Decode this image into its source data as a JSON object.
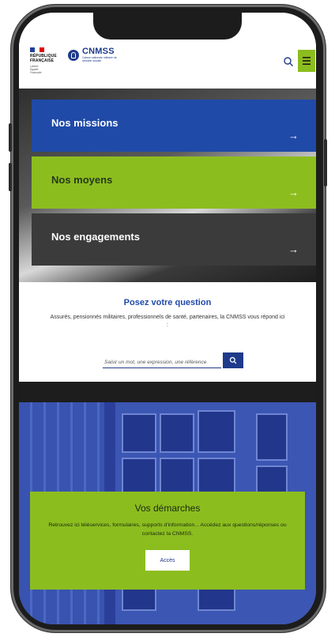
{
  "header": {
    "rf_lines": [
      "RÉPUBLIQUE",
      "FRANÇAISE"
    ],
    "rf_motto": [
      "Liberté",
      "Égalité",
      "Fraternité"
    ],
    "brand_name": "CNMSS",
    "brand_sub": "Caisse nationale militaire de sécurité sociale"
  },
  "tiles": [
    {
      "label": "Nos missions",
      "arrow": "→",
      "color": "#1f4aa8"
    },
    {
      "label": "Nos moyens",
      "arrow": "→",
      "color": "#8cbd1f"
    },
    {
      "label": "Nos engagements",
      "arrow": "→",
      "color": "#3b3b3b"
    }
  ],
  "question": {
    "title": "Posez votre question",
    "description": "Assurés, pensionnés militaires, professionnels de santé, partenaires, la CNMSS vous répond ici",
    "colon": ":",
    "placeholder": "Saisir un mot, une expression, une référence"
  },
  "demarches": {
    "title": "Vos démarches",
    "description": "Retrouvez ici téléservices, formulaires, supports d'information... Accédez aux questions/réponses ou contactez la CNMSS.",
    "button": "Accès"
  },
  "colors": {
    "blue": "#1f4aa8",
    "green": "#8cbd1f",
    "dark": "#3b3b3b",
    "navy": "#1e3a8a"
  },
  "icons": [
    "search-icon",
    "menu-icon",
    "arrow-right-icon"
  ]
}
